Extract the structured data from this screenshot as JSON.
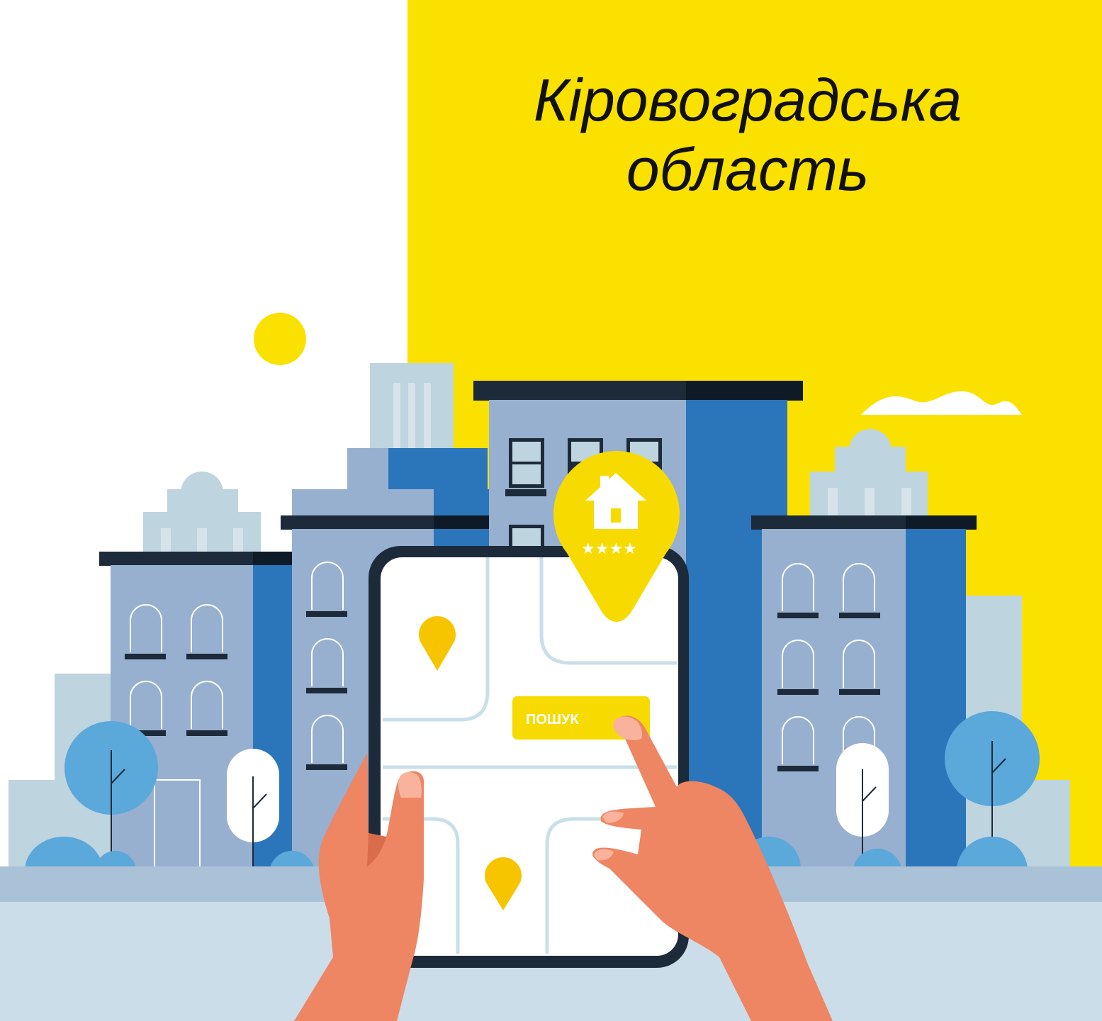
{
  "title": {
    "line1": "Кіровоградська",
    "line2": "область"
  },
  "search_button": {
    "label": "ПОШУК"
  },
  "map_pin": {
    "icon": "house-icon",
    "rating_stars": 4,
    "rating_max": 4
  },
  "colors": {
    "yellow": "#FAE100",
    "building_light": "#97B0CF",
    "building_blue": "#2B75BB",
    "roof_dark": "#1C2A3A",
    "tree_blue": "#5BA8DA",
    "hand": "#EE8563",
    "ground_dark": "#A9C2D8",
    "ground_light": "#CCDDEA"
  }
}
